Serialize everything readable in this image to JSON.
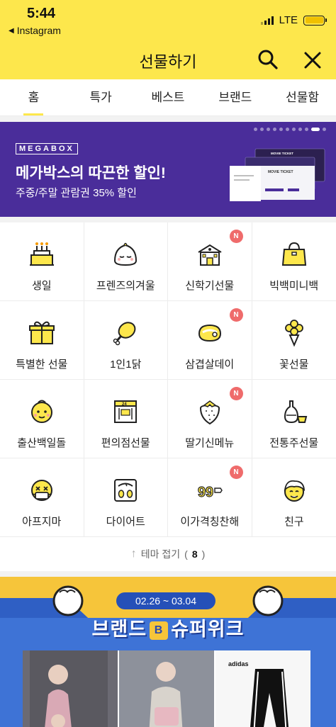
{
  "status": {
    "time": "5:44",
    "back_app": "Instagram",
    "network": "LTE"
  },
  "header": {
    "title": "선물하기"
  },
  "tabs": [
    {
      "label": "홈",
      "active": true
    },
    {
      "label": "특가",
      "active": false
    },
    {
      "label": "베스트",
      "active": false
    },
    {
      "label": "브랜드",
      "active": false
    },
    {
      "label": "선물함",
      "active": false
    }
  ],
  "banner": {
    "brand": "MEGABOX",
    "title": "메가박스의 따끈한 할인!",
    "subtitle": "주중/주말 관람권 35% 할인",
    "ticket_text": "MOVIE TICKET",
    "background": "#4a2d9a"
  },
  "themes": [
    {
      "label": "생일",
      "icon": "birthday-cake-icon",
      "new": ""
    },
    {
      "label": "프렌즈의겨울",
      "icon": "friends-character-icon",
      "new": ""
    },
    {
      "label": "신학기선물",
      "icon": "school-building-icon",
      "new": "N"
    },
    {
      "label": "빅백미니백",
      "icon": "handbag-icon",
      "new": ""
    },
    {
      "label": "특별한 선물",
      "icon": "gift-icon",
      "new": ""
    },
    {
      "label": "1인1닭",
      "icon": "chicken-leg-icon",
      "new": ""
    },
    {
      "label": "삼겹살데이",
      "icon": "meat-icon",
      "new": "N"
    },
    {
      "label": "꽃선물",
      "icon": "flower-bouquet-icon",
      "new": ""
    },
    {
      "label": "출산백일돌",
      "icon": "baby-face-icon",
      "new": ""
    },
    {
      "label": "편의점선물",
      "icon": "convenience-store-icon",
      "new": ""
    },
    {
      "label": "딸기신메뉴",
      "icon": "strawberry-icon",
      "new": "N"
    },
    {
      "label": "전통주선물",
      "icon": "traditional-liquor-icon",
      "new": ""
    },
    {
      "label": "아프지마",
      "icon": "sick-face-icon",
      "new": ""
    },
    {
      "label": "다이어트",
      "icon": "scale-icon",
      "new": ""
    },
    {
      "label": "이가격칭찬해",
      "icon": "price-tag-icon",
      "new": "N"
    },
    {
      "label": "친구",
      "icon": "friend-face-icon",
      "new": ""
    }
  ],
  "fold": {
    "label": "테마 접기",
    "open_paren": "(",
    "count": "8",
    "close_paren": ")"
  },
  "promo": {
    "date_range": "02.26 ~ 03.04",
    "title_left": "브랜드",
    "title_mid": "B",
    "title_right": "슈퍼위크",
    "brand_label": "adidas",
    "background": "#3e73d6"
  },
  "colors": {
    "accent": "#fde74c",
    "new_badge": "#ef6b6b"
  }
}
